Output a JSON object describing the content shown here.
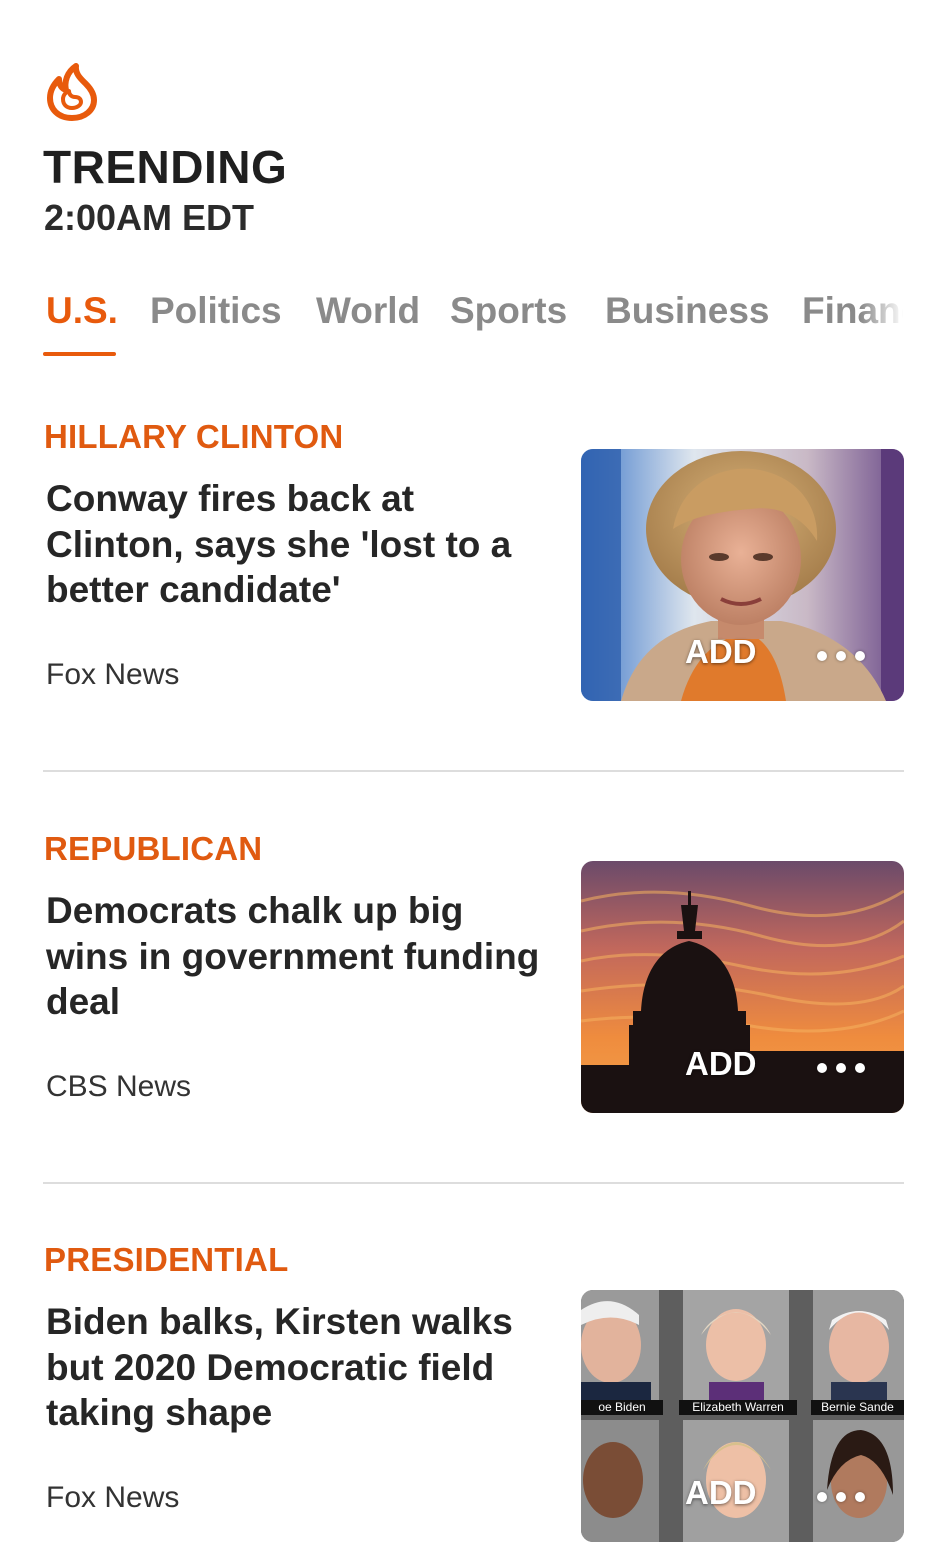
{
  "header": {
    "icon": "flame-icon",
    "title": "TRENDING",
    "time": "2:00AM EDT"
  },
  "tabs": [
    {
      "label": "U.S.",
      "active": true
    },
    {
      "label": "Politics",
      "active": false
    },
    {
      "label": "World",
      "active": false
    },
    {
      "label": "Sports",
      "active": false
    },
    {
      "label": "Business",
      "active": false
    },
    {
      "label": "Finance",
      "active": false
    }
  ],
  "colors": {
    "accent": "#e85a0c",
    "divider": "#dddddd",
    "tab_inactive": "#8a8a8a"
  },
  "stories": [
    {
      "topic": "HILLARY CLINTON",
      "headline": "Conway fires back at Clinton, says she 'lost to a better candidate'",
      "source": "Fox News",
      "add_label": "ADD",
      "more_icon": "more-dots-icon"
    },
    {
      "topic": "REPUBLICAN",
      "headline": "Democrats chalk up big wins in government funding deal",
      "source": "CBS News",
      "add_label": "ADD",
      "more_icon": "more-dots-icon"
    },
    {
      "topic": "PRESIDENTIAL",
      "headline": "Biden balks, Kirsten walks but 2020 Democratic field taking shape",
      "source": "Fox News",
      "add_label": "ADD",
      "more_icon": "more-dots-icon",
      "image_captions": [
        "oe Biden",
        "Elizabeth Warren",
        "Bernie Sande"
      ]
    }
  ]
}
